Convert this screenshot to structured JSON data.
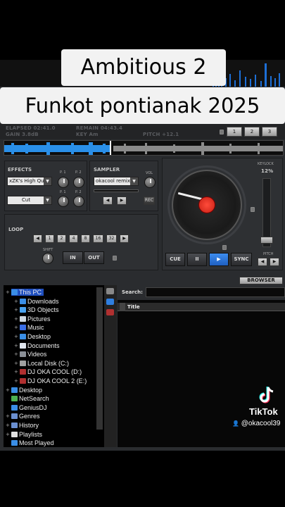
{
  "overlay": {
    "title_line1": "Ambitious 2",
    "title_line2": "Funkot pontianak 2025"
  },
  "deck_info": {
    "elapsed": "ELAPSED 02:41.0",
    "gain": "GAIN 3.8dB",
    "remain": "REMAIN 04:43.4",
    "key": "KEY Am",
    "pitch": "PITCH +12.1",
    "deck_buttons": [
      "1",
      "2",
      "3"
    ]
  },
  "effects": {
    "title": "EFFECTS",
    "effect_select": "xZK's High Qu",
    "cut_select": "Cut",
    "knob_labels": [
      "P. 1",
      "P. 2",
      "P. 1",
      "P. 2"
    ]
  },
  "sampler": {
    "title": "SAMPLER",
    "vol_label": "VOL",
    "sample_select": "okacool remix",
    "rec_label": "REC"
  },
  "loop": {
    "title": "LOOP",
    "sizes": [
      "1",
      "2",
      "4",
      "8",
      "16",
      "32"
    ],
    "shift_label": "SHIFT",
    "in_label": "IN",
    "out_label": "OUT"
  },
  "transport": {
    "cue_label": "CUE",
    "pause_label": "II",
    "play_label": "▶",
    "sync_label": "SYNC"
  },
  "pitch": {
    "keylock_label": "KEYLOCK",
    "range": "12%",
    "pitch_label": "PITCH"
  },
  "browser": {
    "browser_button": "BROWSER",
    "search_label": "Search:",
    "search_value": "",
    "column_title": "Title",
    "tree": [
      {
        "label": "This PC",
        "color": "#3a8ee6"
      },
      {
        "label": "Downloads",
        "color": "#3a8ee6"
      },
      {
        "label": "3D Objects",
        "color": "#4aa3f0"
      },
      {
        "label": "Pictures",
        "color": "#cfd8e0"
      },
      {
        "label": "Music",
        "color": "#3a6ee6"
      },
      {
        "label": "Desktop",
        "color": "#3a8ee6"
      },
      {
        "label": "Documents",
        "color": "#dfe6ee"
      },
      {
        "label": "Videos",
        "color": "#8a8f96"
      },
      {
        "label": "Local Disk (C:)",
        "color": "#a0a0a0"
      },
      {
        "label": "DJ OKA COOL (D:)",
        "color": "#b03030"
      },
      {
        "label": "DJ OKA COOL 2 (E:)",
        "color": "#b03030"
      },
      {
        "label": "Desktop",
        "color": "#3a8ee6"
      },
      {
        "label": "NetSearch",
        "color": "#4caf50"
      },
      {
        "label": "GeniusDJ",
        "color": "#3a8ee6"
      },
      {
        "label": "Genres",
        "color": "#6a8fd0"
      },
      {
        "label": "History",
        "color": "#6a8fd0"
      },
      {
        "label": "Playlists",
        "color": "#e0e0e0"
      },
      {
        "label": "Most Played",
        "color": "#3a8ee6"
      }
    ]
  },
  "tiktok": {
    "brand": "TikTok",
    "user": "@okacool39"
  },
  "colors": {
    "accent_blue": "#2f7fe0",
    "tree_highlight": "#1f4fbf",
    "platter_red": "#e0301e"
  }
}
